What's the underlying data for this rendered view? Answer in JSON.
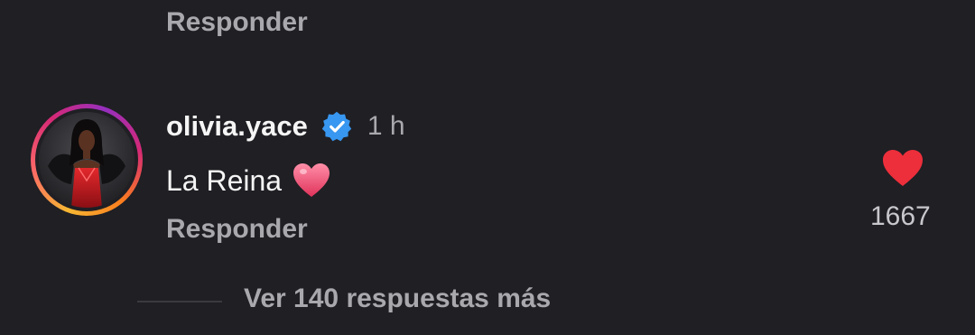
{
  "reply_top": {
    "label": "Responder"
  },
  "comment": {
    "username": "olivia.yace",
    "verified": true,
    "time": "1 h",
    "text": "La Reina",
    "emoji": "pink-heart-emoji",
    "reply_label": "Responder",
    "like_count": "1667",
    "liked": true
  },
  "more_replies": {
    "label": "Ver 140 respuestas más"
  },
  "colors": {
    "background": "#1f1f24",
    "secondary_text": "#a8a8ad",
    "primary_text": "#f5f5f5",
    "verified_blue": "#3897f0",
    "like_red": "#ed2f3b"
  }
}
